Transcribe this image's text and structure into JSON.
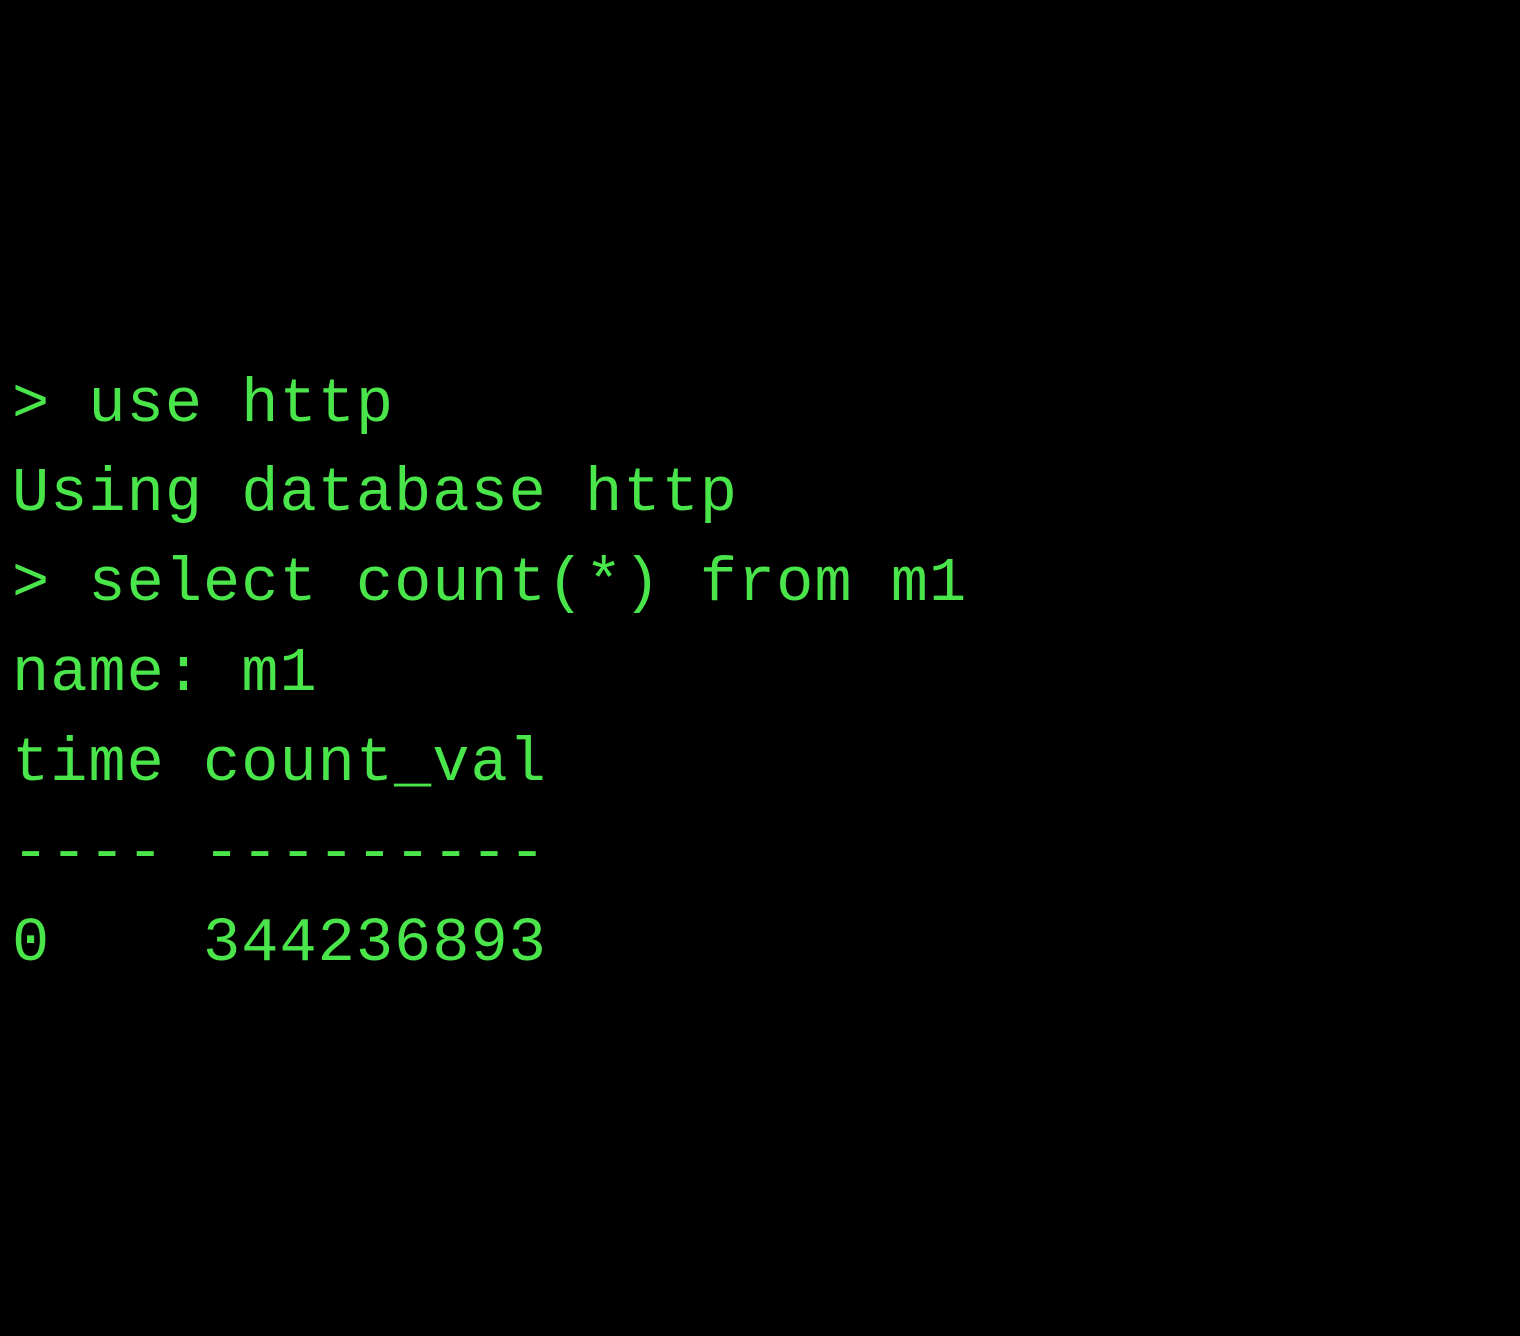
{
  "terminal": {
    "prompt": "> ",
    "lines": {
      "cmd1": "use http",
      "response1": "Using database http",
      "cmd2": "select count(*) from m1",
      "name_line": "name: m1",
      "header_line": "time count_val",
      "divider_line": "---- ---------",
      "data_line": "0    344236893"
    }
  }
}
